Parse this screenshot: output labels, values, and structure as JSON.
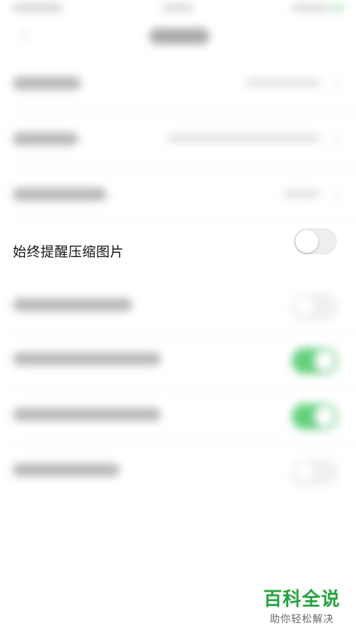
{
  "settings": {
    "focused_item": {
      "label": "始终提醒压缩图片",
      "toggle_state": "off"
    }
  },
  "colors": {
    "switch_on": "#63d07c",
    "switch_off": "#eeeeee",
    "watermark_green": "#24a33c"
  },
  "watermark": {
    "title": "百科全说",
    "subtitle": "助你轻松解决"
  }
}
